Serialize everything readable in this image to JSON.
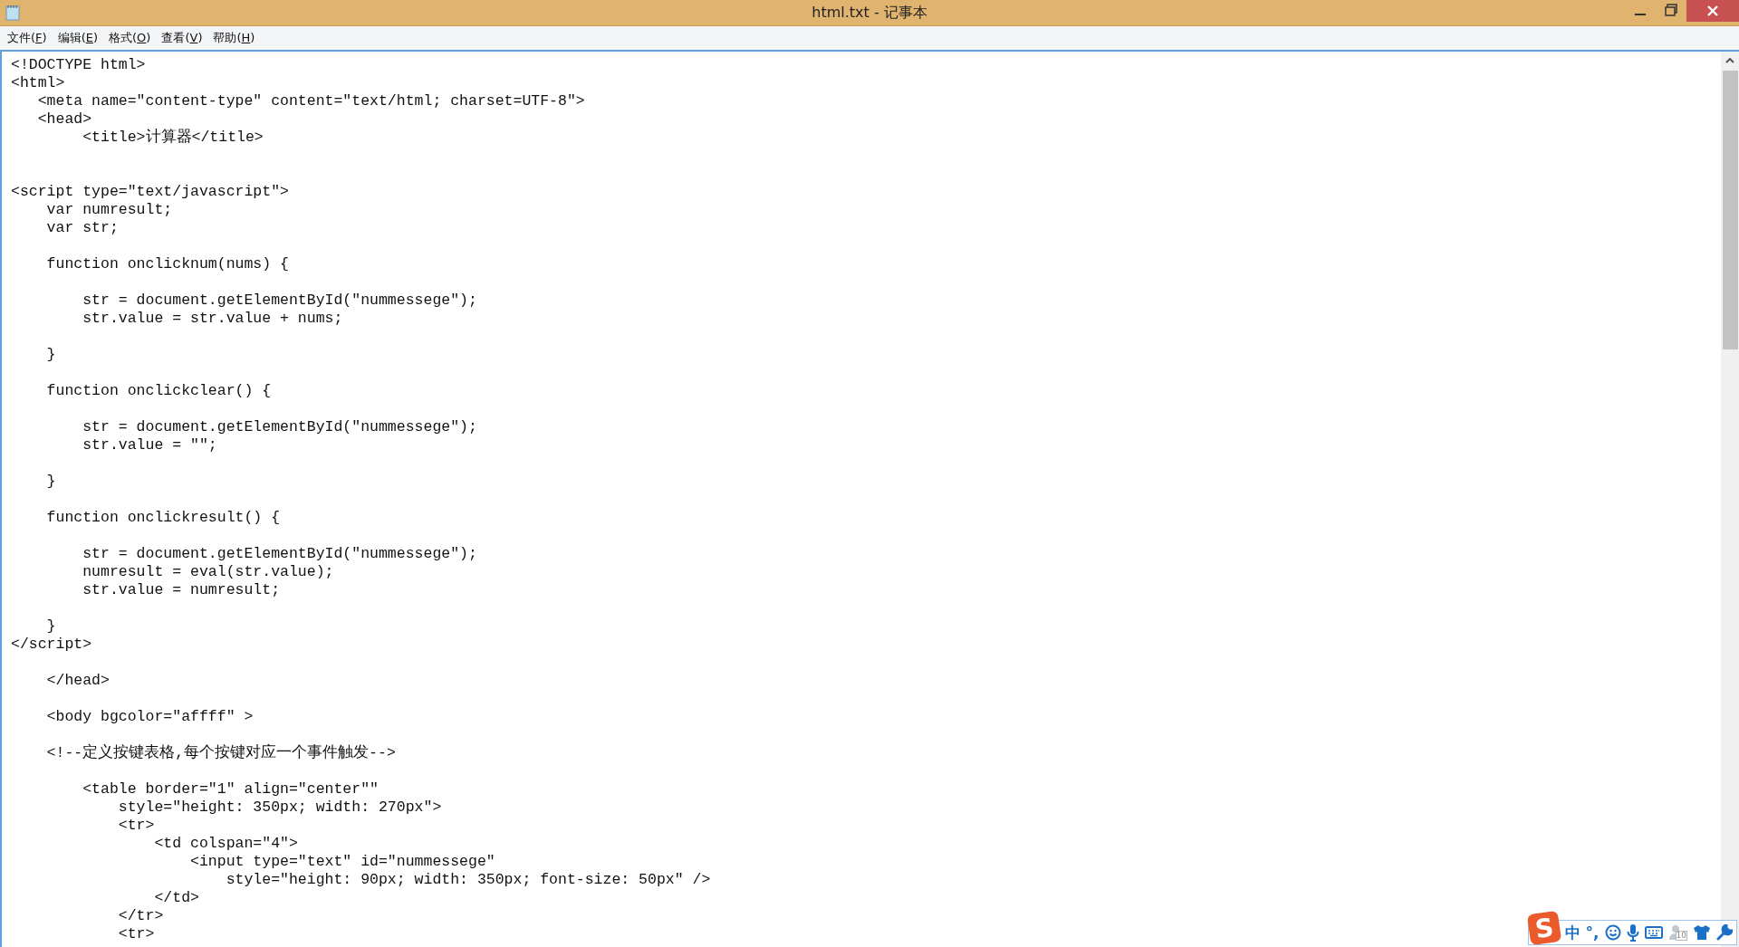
{
  "window": {
    "title": "html.txt - 记事本"
  },
  "menu": [
    {
      "label": "文件(F)"
    },
    {
      "label": "编辑(E)"
    },
    {
      "label": "格式(O)"
    },
    {
      "label": "查看(V)"
    },
    {
      "label": "帮助(H)"
    }
  ],
  "editor": {
    "lines": [
      {
        "kind": "text",
        "text": "<!DOCTYPE html>"
      },
      {
        "kind": "text",
        "text": "<html>"
      },
      {
        "kind": "text",
        "text": "   <meta name=\"content-type\" content=\"text/html; charset=UTF-8\">"
      },
      {
        "kind": "text",
        "text": "   <head>"
      },
      {
        "kind": "text",
        "text": "        <title>计算器</title>"
      },
      {
        "kind": "blank"
      },
      {
        "kind": "blank"
      },
      {
        "kind": "text",
        "text": "<script type=\"text/javascript\">"
      },
      {
        "kind": "text",
        "text": "    var numresult;"
      },
      {
        "kind": "text",
        "text": "    var str;"
      },
      {
        "kind": "blank"
      },
      {
        "kind": "text",
        "text": "    function onclicknum(nums) {"
      },
      {
        "kind": "blank"
      },
      {
        "kind": "text",
        "text": "        str = document.getElementById(\"nummessege\");"
      },
      {
        "kind": "text",
        "text": "        str.value = str.value + nums;"
      },
      {
        "kind": "blank"
      },
      {
        "kind": "text",
        "text": "    }"
      },
      {
        "kind": "blank"
      },
      {
        "kind": "text",
        "text": "    function onclickclear() {"
      },
      {
        "kind": "blank"
      },
      {
        "kind": "text",
        "text": "        str = document.getElementById(\"nummessege\");"
      },
      {
        "kind": "text",
        "text": "        str.value = \"\";"
      },
      {
        "kind": "blank"
      },
      {
        "kind": "text",
        "text": "    }"
      },
      {
        "kind": "blank"
      },
      {
        "kind": "text",
        "text": "    function onclickresult() {"
      },
      {
        "kind": "blank"
      },
      {
        "kind": "text",
        "text": "        str = document.getElementById(\"nummessege\");"
      },
      {
        "kind": "text",
        "text": "        numresult = eval(str.value);"
      },
      {
        "kind": "text",
        "text": "        str.value = numresult;"
      },
      {
        "kind": "blank"
      },
      {
        "kind": "text",
        "text": "    }"
      },
      {
        "kind": "text",
        "text": "</script>"
      },
      {
        "kind": "blank"
      },
      {
        "kind": "text",
        "text": "    </head>"
      },
      {
        "kind": "blank"
      },
      {
        "kind": "text",
        "text": "    <body bgcolor=\"affff\" >"
      },
      {
        "kind": "blank"
      },
      {
        "kind": "text",
        "text": "    <!--定义按键表格,每个按键对应一个事件触发-->"
      },
      {
        "kind": "blank"
      },
      {
        "kind": "text",
        "text": "        <table border=\"1\" align=\"center\"\""
      },
      {
        "kind": "text",
        "text": "            style=\"height: 350px; width: 270px\">"
      },
      {
        "kind": "text",
        "text": "            <tr>"
      },
      {
        "kind": "text",
        "text": "                <td colspan=\"4\">"
      },
      {
        "kind": "text",
        "text": "                    <input type=\"text\" id=\"nummessege\""
      },
      {
        "kind": "text",
        "text": "                        style=\"height: 90px; width: 350px; font-size: 50px\" />"
      },
      {
        "kind": "text",
        "text": "                </td>"
      },
      {
        "kind": "text",
        "text": "            </tr>"
      },
      {
        "kind": "text",
        "text": "            <tr>"
      }
    ]
  },
  "ime_toolbar": {
    "logo": "S",
    "mode": "中",
    "punctuation": "°,",
    "badge": "10"
  }
}
